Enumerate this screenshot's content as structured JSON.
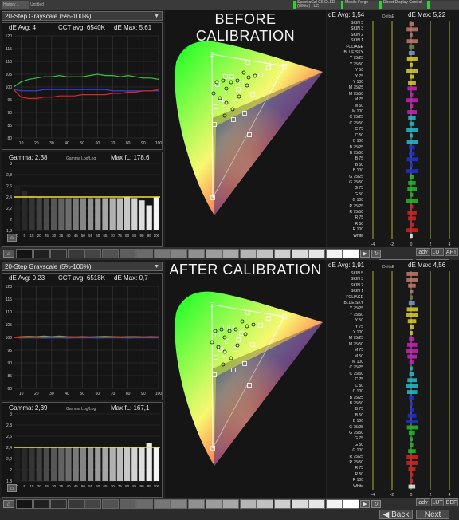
{
  "topbar": {
    "tabs": [
      "History 1",
      "Untitled"
    ],
    "devices": [
      "SpectraCal C6 OLED (White) - LG",
      "Mobile Forge",
      "Direct Display Control"
    ]
  },
  "panels": [
    {
      "title": "BEFORE CALIBRATION",
      "dropdown": "20-Step Grayscale (5%-100%)",
      "de_avg": "dE Avg: 4",
      "cct_avg": "CCT avg: 6540K",
      "de_max": "dE Max: 5,61",
      "gamma": "Gamma: 2,38",
      "gamma_mode": "Gamma Log/Log",
      "max_fl": "Max fL: 178,6",
      "right_de_avg": "dE Avg: 1,54",
      "right_delta": "DeltaE",
      "right_de_max": "dE Max: 5,22",
      "nav_label": "Back",
      "next_label": "Next",
      "btn_a": "adv",
      "btn_b": "LUT",
      "btn_c": "AFT"
    },
    {
      "title": "AFTER CALIBRATION",
      "dropdown": "20-Step Grayscale (5%-100%)",
      "de_avg": "dE Avg: 0,23",
      "cct_avg": "CCT avg: 6518K",
      "de_max": "dE Max: 0,7",
      "gamma": "Gamma: 2,39",
      "gamma_mode": "Gamma Log/Log",
      "max_fl": "Max fL: 167,1",
      "right_de_avg": "dE Avg: 1,91",
      "right_delta": "DeltaE",
      "right_de_max": "dE Max: 4,56",
      "nav_label": "Back",
      "next_label": "Next",
      "btn_a": "adv",
      "btn_b": "LUT",
      "btn_c": "BEF"
    }
  ],
  "rgb_chart": {
    "x_ticks": [
      "10",
      "20",
      "30",
      "40",
      "50",
      "60",
      "70",
      "80",
      "90",
      "100"
    ],
    "y_ticks": [
      "120",
      "115",
      "110",
      "105",
      "100",
      "95",
      "90",
      "85",
      "80"
    ]
  },
  "gamma_chart": {
    "y_ticks": [
      "3",
      "2,8",
      "2,6",
      "2,4",
      "2,2",
      "2",
      "1,8"
    ],
    "x_ticks": [
      "0",
      "5",
      "15",
      "20",
      "25",
      "30",
      "35",
      "40",
      "45",
      "50",
      "55",
      "60",
      "65",
      "70",
      "75",
      "80",
      "85",
      "90",
      "95",
      "100"
    ]
  },
  "delta_axis": [
    "-4",
    "-2",
    "0",
    "2",
    "4"
  ],
  "categories": [
    "SKIN 5",
    "SKIN 3",
    "SKIN 2",
    "SKIN 1",
    "FOLIAGE",
    "BLUE SKY",
    "Y 75/25",
    "Y 75/50",
    "Y 50",
    "Y 75",
    "Y 100",
    "M 75/25",
    "M 75/50",
    "M 75",
    "M 50",
    "M 100",
    "C 75/25",
    "C 75/50",
    "C 75",
    "C 50",
    "C 100",
    "B 75/25",
    "B 75/50",
    "B 75",
    "B 50",
    "B 100",
    "G 75/25",
    "G 75/50",
    "G 75",
    "G 50",
    "G 100",
    "R 75/25",
    "R 75/50",
    "R 75",
    "R 50",
    "R 100",
    "White"
  ],
  "chart_data": [
    {
      "type": "line",
      "title": "",
      "x": [
        5,
        10,
        15,
        20,
        25,
        30,
        35,
        40,
        45,
        50,
        55,
        60,
        65,
        70,
        75,
        80,
        85,
        90,
        95,
        100
      ],
      "ylim": [
        80,
        120
      ],
      "series": [
        {
          "color": "#3fbf3f",
          "values": [
            100,
            102,
            103,
            103.5,
            104,
            104,
            104.5,
            104,
            104,
            104,
            104.5,
            105,
            104.5,
            104.5,
            104,
            104.5,
            104,
            103.5,
            103.5,
            103
          ]
        },
        {
          "color": "#3a46e8",
          "values": [
            99,
            98.5,
            98.5,
            98.5,
            99,
            99,
            99,
            99,
            99,
            99,
            99,
            99,
            99,
            98.5,
            98.5,
            98.5,
            98.5,
            98.5,
            98.5,
            98.5
          ]
        },
        {
          "color": "#e02424",
          "values": [
            99,
            96,
            95.5,
            95.5,
            96,
            96,
            96.5,
            96.5,
            96.5,
            97,
            97,
            97,
            97,
            97.5,
            97.5,
            98,
            98,
            98.5,
            98.5,
            99
          ]
        }
      ]
    },
    {
      "type": "bar",
      "title": "",
      "ylim": [
        1.8,
        3
      ],
      "values": [
        2.6,
        2.5,
        2.42,
        2.4,
        2.38,
        2.38,
        2.38,
        2.38,
        2.38,
        2.38,
        2.38,
        2.38,
        2.38,
        2.38,
        2.38,
        2.4,
        2.38,
        2.34,
        2.25,
        2.4
      ],
      "target": 2.4
    },
    {
      "type": "line",
      "title": "",
      "x": [
        5,
        10,
        15,
        20,
        25,
        30,
        35,
        40,
        45,
        50,
        55,
        60,
        65,
        70,
        75,
        80,
        85,
        90,
        95,
        100
      ],
      "ylim": [
        80,
        120
      ],
      "series": [
        {
          "color": "#3fbf3f",
          "values": [
            100,
            100.3,
            100.4,
            100.3,
            100.5,
            100.3,
            100.5,
            100.3,
            100.2,
            100.3,
            100.2,
            100.3,
            100.4,
            100.3,
            100.2,
            100.3,
            100.3,
            100.2,
            100.3,
            100.2
          ]
        },
        {
          "color": "#3a46e8",
          "values": [
            100,
            99.7,
            99.8,
            99.8,
            99.7,
            99.8,
            99.8,
            99.7,
            99.8,
            99.8,
            99.8,
            99.7,
            99.8,
            99.8,
            99.8,
            99.7,
            99.8,
            99.8,
            99.8,
            99.8
          ]
        },
        {
          "color": "#e02424",
          "values": [
            100,
            99.8,
            100,
            99.9,
            100,
            100.1,
            100,
            100,
            99.9,
            100,
            100,
            100.1,
            100,
            100,
            99.9,
            100,
            100,
            100,
            100,
            100
          ]
        }
      ]
    },
    {
      "type": "bar",
      "title": "",
      "ylim": [
        1.8,
        3
      ],
      "values": [
        2.42,
        2.4,
        2.4,
        2.4,
        2.4,
        2.4,
        2.4,
        2.4,
        2.4,
        2.4,
        2.4,
        2.4,
        2.4,
        2.4,
        2.4,
        2.4,
        2.4,
        2.4,
        2.48,
        2.4
      ],
      "target": 2.4
    }
  ]
}
